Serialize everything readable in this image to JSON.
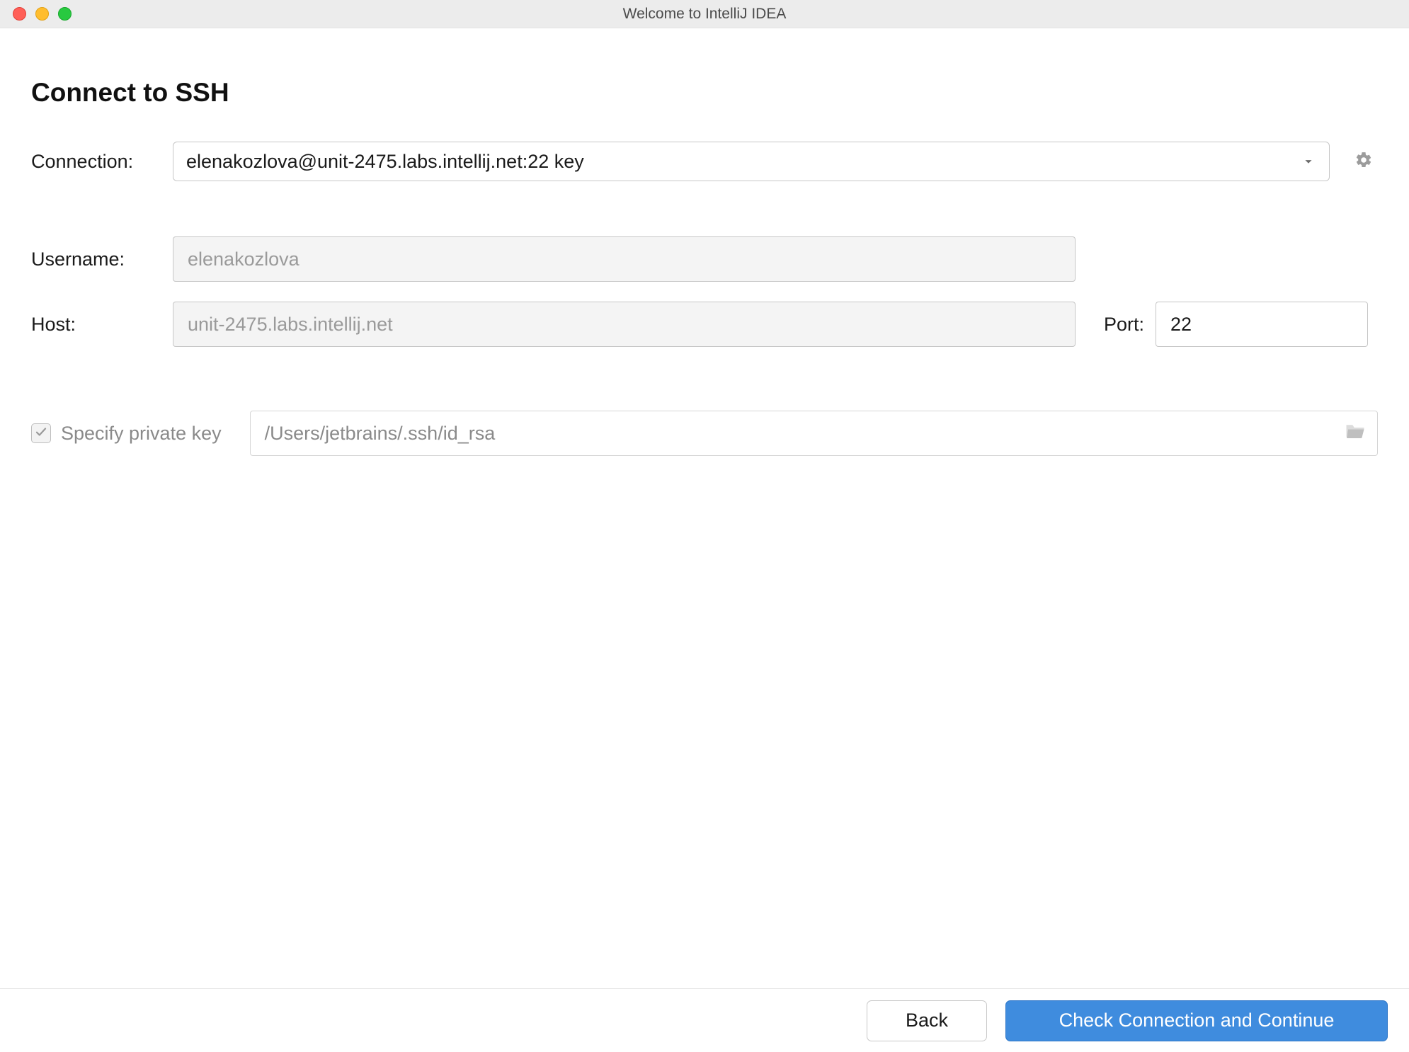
{
  "window": {
    "title": "Welcome to IntelliJ IDEA"
  },
  "page": {
    "title": "Connect to SSH"
  },
  "connection": {
    "label": "Connection:",
    "selected": "elenakozlova@unit-2475.labs.intellij.net:22 key"
  },
  "username": {
    "label": "Username:",
    "value": "elenakozlova"
  },
  "host": {
    "label": "Host:",
    "value": "unit-2475.labs.intellij.net"
  },
  "port": {
    "label": "Port:",
    "value": "22"
  },
  "private_key": {
    "checkbox_label": "Specify private key",
    "path": "/Users/jetbrains/.ssh/id_rsa",
    "checked": true
  },
  "buttons": {
    "back": "Back",
    "continue": "Check Connection and Continue"
  }
}
